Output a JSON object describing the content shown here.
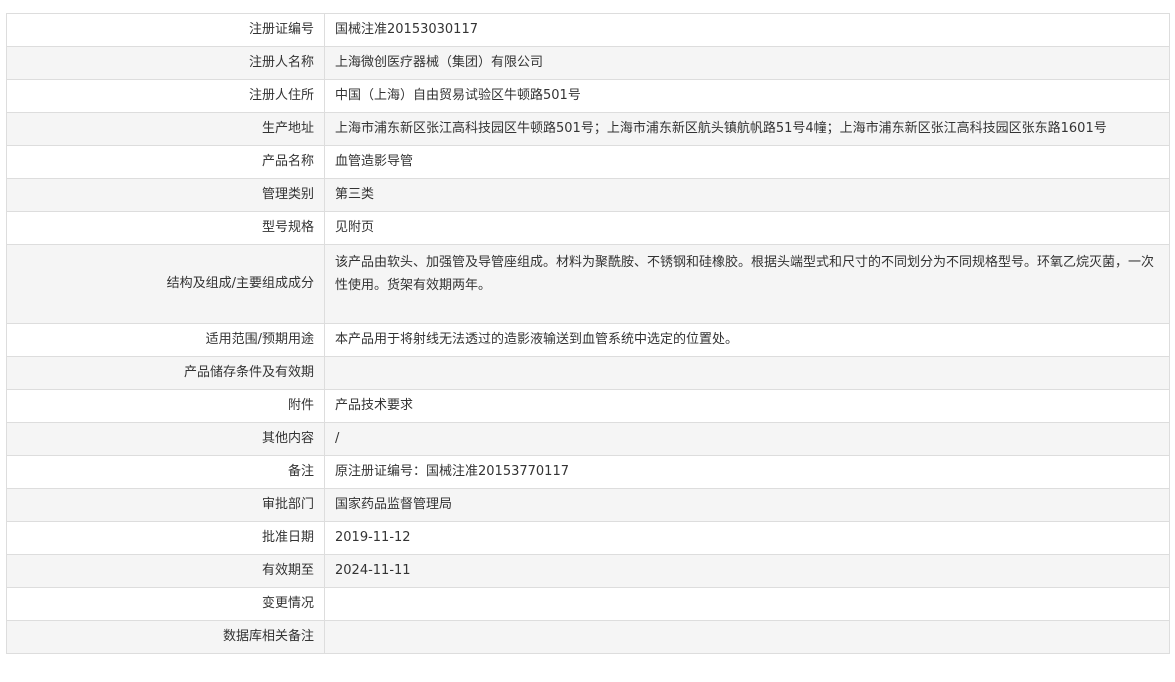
{
  "rows": [
    {
      "label": "注册证编号",
      "value": "国械注准20153030117"
    },
    {
      "label": "注册人名称",
      "value": "上海微创医疗器械（集团）有限公司"
    },
    {
      "label": "注册人住所",
      "value": "中国（上海）自由贸易试验区牛顿路501号"
    },
    {
      "label": "生产地址",
      "value": "上海市浦东新区张江高科技园区牛顿路501号；上海市浦东新区航头镇航帆路51号4幢；上海市浦东新区张江高科技园区张东路1601号"
    },
    {
      "label": "产品名称",
      "value": "血管造影导管"
    },
    {
      "label": "管理类别",
      "value": "第三类"
    },
    {
      "label": "型号规格",
      "value": "见附页"
    },
    {
      "label": "结构及组成/主要组成成分",
      "value": "该产品由软头、加强管及导管座组成。材料为聚酰胺、不锈钢和硅橡胶。根据头端型式和尺寸的不同划分为不同规格型号。环氧乙烷灭菌，一次性使用。货架有效期两年。"
    },
    {
      "label": "适用范围/预期用途",
      "value": "本产品用于将射线无法透过的造影液输送到血管系统中选定的位置处。"
    },
    {
      "label": "产品储存条件及有效期",
      "value": ""
    },
    {
      "label": "附件",
      "value": "产品技术要求"
    },
    {
      "label": "其他内容",
      "value": "/"
    },
    {
      "label": "备注",
      "value": "原注册证编号：国械注准20153770117"
    },
    {
      "label": "审批部门",
      "value": "国家药品监督管理局"
    },
    {
      "label": "批准日期",
      "value": "2019-11-12"
    },
    {
      "label": "有效期至",
      "value": "2024-11-11"
    },
    {
      "label": "变更情况",
      "value": ""
    },
    {
      "label": "数据库相关备注",
      "value": ""
    }
  ]
}
